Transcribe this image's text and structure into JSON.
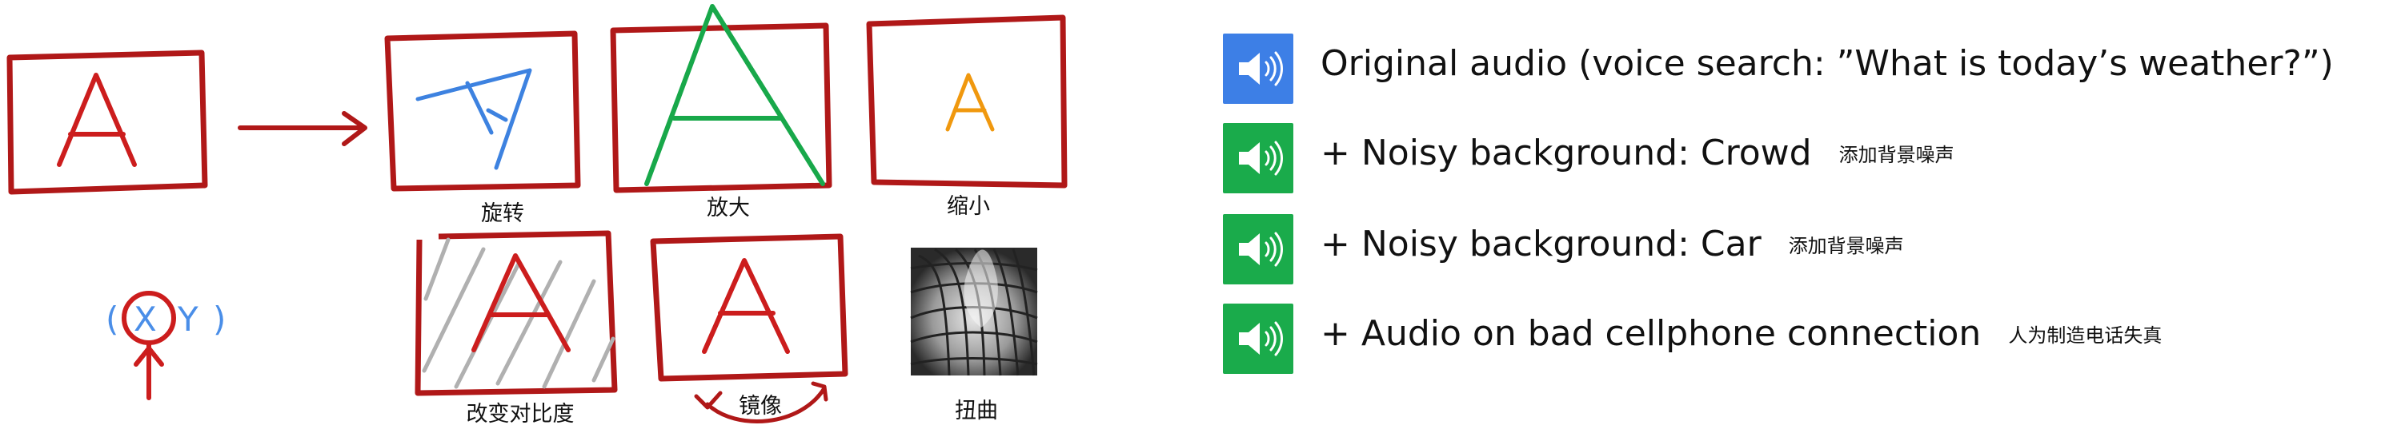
{
  "augmentation_panel": {
    "captions": {
      "rotate": "旋转",
      "zoom_in": "放大",
      "zoom_out": "缩小",
      "contrast": "改变对比度",
      "mirror": "镜像",
      "distort": "扭曲"
    },
    "letter": "A",
    "coordinate_label": {
      "open_paren": "(",
      "x": "X",
      "y": "Y",
      "close_paren": ")"
    }
  },
  "audio_examples": [
    {
      "label": "Original audio (voice search: ”What is today’s weather?”)",
      "note": "",
      "icon": "speaker-icon",
      "color": "#3d7fe6"
    },
    {
      "label": "+ Noisy background: Crowd",
      "note": "添加背景噪声",
      "icon": "speaker-icon",
      "color": "#1aab4b"
    },
    {
      "label": "+ Noisy background: Car",
      "note": "添加背景噪声",
      "icon": "speaker-icon",
      "color": "#1aab4b"
    },
    {
      "label": "+ Audio on bad cellphone connection",
      "note": "人为制造电话失真",
      "icon": "speaker-icon",
      "color": "#1aab4b"
    }
  ],
  "colors": {
    "frame_red": "#b01818",
    "letter_red": "#cc1d1d",
    "rotate_blue": "#3d82e0",
    "zoom_green": "#18a84a",
    "shrink_orange": "#f0980e",
    "contrast_gray": "#b0b0b0",
    "coord_blue": "#4a8ee8"
  }
}
